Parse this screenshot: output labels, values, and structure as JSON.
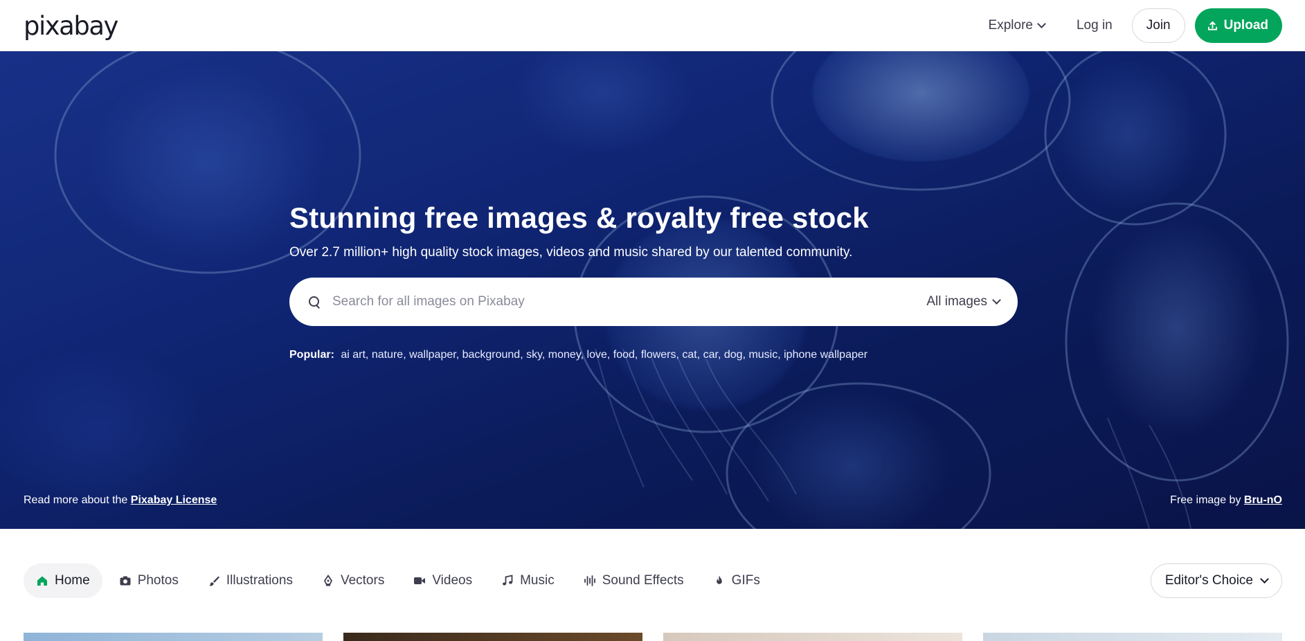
{
  "header": {
    "logo": "pixabay",
    "explore_label": "Explore",
    "login_label": "Log in",
    "join_label": "Join",
    "upload_label": "Upload"
  },
  "hero": {
    "title": "Stunning free images & royalty free stock",
    "subtitle": "Over 2.7 million+ high quality stock images, videos and music shared by our talented community.",
    "search": {
      "placeholder": "Search for all images on Pixabay",
      "scope_label": "All images"
    },
    "popular": {
      "label": "Popular:",
      "terms": [
        "ai art",
        "nature",
        "wallpaper",
        "background",
        "sky",
        "money",
        "love",
        "food",
        "flowers",
        "cat",
        "car",
        "dog",
        "music",
        "iphone wallpaper"
      ]
    },
    "license": {
      "prefix": "Read more about the",
      "link": "Pixabay License"
    },
    "credit": {
      "prefix": "Free image by",
      "author": "Bru-nO"
    }
  },
  "categories": {
    "tabs": [
      {
        "label": "Home",
        "icon": "home-icon"
      },
      {
        "label": "Photos",
        "icon": "camera-icon"
      },
      {
        "label": "Illustrations",
        "icon": "brush-icon"
      },
      {
        "label": "Vectors",
        "icon": "pen-nib-icon"
      },
      {
        "label": "Videos",
        "icon": "video-camera-icon"
      },
      {
        "label": "Music",
        "icon": "music-note-icon"
      },
      {
        "label": "Sound Effects",
        "icon": "waveform-icon"
      },
      {
        "label": "GIFs",
        "icon": "flame-icon"
      }
    ],
    "active_tab": "Home",
    "sort_label": "Editor's Choice"
  },
  "colors": {
    "brand_green": "#02a55b",
    "hero_blue": "#132c86",
    "text_dark": "#191b26"
  }
}
